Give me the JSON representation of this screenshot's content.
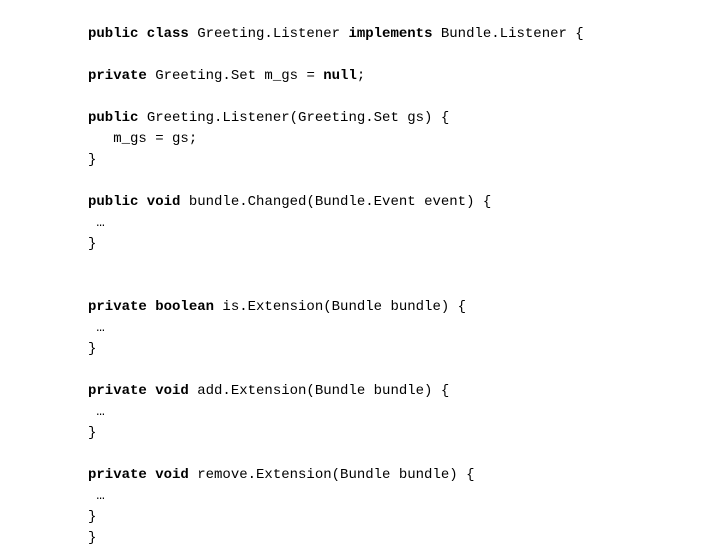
{
  "lines": [
    {
      "parts": [
        {
          "bold": true,
          "text": "public class "
        },
        {
          "bold": false,
          "text": "Greeting.Listener "
        },
        {
          "bold": true,
          "text": "implements "
        },
        {
          "bold": false,
          "text": "Bundle.Listener {"
        }
      ]
    },
    {
      "spacer": true
    },
    {
      "parts": [
        {
          "bold": true,
          "text": "private "
        },
        {
          "bold": false,
          "text": "Greeting.Set m_gs = "
        },
        {
          "bold": true,
          "text": "null"
        },
        {
          "bold": false,
          "text": ";"
        }
      ]
    },
    {
      "spacer": true
    },
    {
      "parts": [
        {
          "bold": true,
          "text": "public "
        },
        {
          "bold": false,
          "text": "Greeting.Listener(Greeting.Set gs) {"
        }
      ]
    },
    {
      "parts": [
        {
          "bold": false,
          "text": "   m_gs = gs;"
        }
      ]
    },
    {
      "parts": [
        {
          "bold": false,
          "text": "}"
        }
      ]
    },
    {
      "spacer": true
    },
    {
      "parts": [
        {
          "bold": true,
          "text": "public void "
        },
        {
          "bold": false,
          "text": "bundle.Changed(Bundle.Event event) {"
        }
      ]
    },
    {
      "parts": [
        {
          "bold": false,
          "text": " …"
        }
      ]
    },
    {
      "parts": [
        {
          "bold": false,
          "text": "}"
        }
      ]
    },
    {
      "spacer": true
    },
    {
      "spacer": true
    },
    {
      "parts": [
        {
          "bold": true,
          "text": "private boolean "
        },
        {
          "bold": false,
          "text": "is.Extension(Bundle bundle) {"
        }
      ]
    },
    {
      "parts": [
        {
          "bold": false,
          "text": " …"
        }
      ]
    },
    {
      "parts": [
        {
          "bold": false,
          "text": "}"
        }
      ]
    },
    {
      "spacer": true
    },
    {
      "parts": [
        {
          "bold": true,
          "text": "private void "
        },
        {
          "bold": false,
          "text": "add.Extension(Bundle bundle) {"
        }
      ]
    },
    {
      "parts": [
        {
          "bold": false,
          "text": " …"
        }
      ]
    },
    {
      "parts": [
        {
          "bold": false,
          "text": "}"
        }
      ]
    },
    {
      "spacer": true
    },
    {
      "parts": [
        {
          "bold": true,
          "text": "private void "
        },
        {
          "bold": false,
          "text": "remove.Extension(Bundle bundle) {"
        }
      ]
    },
    {
      "parts": [
        {
          "bold": false,
          "text": " …"
        }
      ]
    },
    {
      "parts": [
        {
          "bold": false,
          "text": "}"
        }
      ]
    },
    {
      "parts": [
        {
          "bold": false,
          "text": "}"
        }
      ]
    }
  ]
}
